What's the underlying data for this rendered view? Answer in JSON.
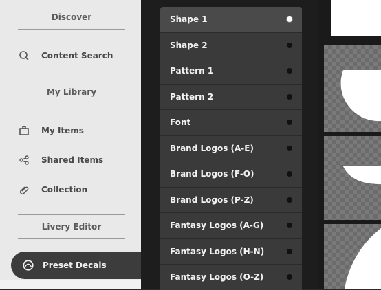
{
  "sidebar": {
    "sections": {
      "discover": "Discover",
      "library": "My Library",
      "livery": "Livery Editor"
    },
    "items": {
      "content_search": "Content Search",
      "my_items": "My Items",
      "shared_items": "Shared Items",
      "collection": "Collection",
      "preset_decals": "Preset Decals"
    }
  },
  "dropdown": {
    "selected": "Shape 1",
    "options": [
      "Shape 1",
      "Shape 2",
      "Pattern 1",
      "Pattern 2",
      "Font",
      "Brand Logos (A-E)",
      "Brand Logos (F-O)",
      "Brand Logos (P-Z)",
      "Fantasy Logos (A-G)",
      "Fantasy Logos (H-N)",
      "Fantasy Logos (O-Z)"
    ]
  },
  "icons": {
    "content_search": "search-icon",
    "my_items": "briefcase-icon",
    "shared_items": "share-icon",
    "collection": "paperclip-icon",
    "preset_decals": "decal-icon",
    "radio_selected": "radio-selected-icon",
    "radio_unselected": "radio-unselected-icon"
  },
  "colors": {
    "sidebar_bg": "#e9e9e9",
    "active_item_bg": "#3c3c3c",
    "dropdown_bg": "#3a3a3a",
    "preview_checker": "#6b6b6b"
  }
}
